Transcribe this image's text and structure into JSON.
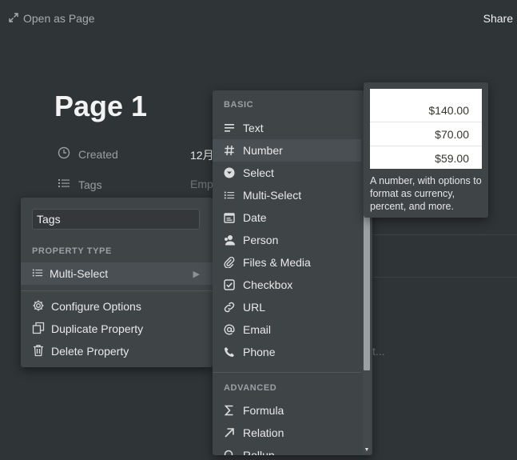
{
  "topbar": {
    "open_as_page": "Open as Page",
    "share": "Share"
  },
  "page": {
    "title": "Page 1",
    "properties": [
      {
        "name": "Created",
        "value": "12月"
      },
      {
        "name": "Tags",
        "value": "Emp"
      }
    ],
    "hidden_text": "t..."
  },
  "prop_menu": {
    "name_value": "Tags",
    "type_header": "PROPERTY TYPE",
    "current_type": "Multi-Select",
    "actions": [
      "Configure Options",
      "Duplicate Property",
      "Delete Property"
    ]
  },
  "type_menu": {
    "basic_header": "BASIC",
    "basic": [
      "Text",
      "Number",
      "Select",
      "Multi-Select",
      "Date",
      "Person",
      "Files & Media",
      "Checkbox",
      "URL",
      "Email",
      "Phone"
    ],
    "advanced_header": "ADVANCED",
    "advanced": [
      "Formula",
      "Relation",
      "Rollup"
    ]
  },
  "tooltip": {
    "values": [
      "$140.00",
      "$70.00",
      "$59.00"
    ],
    "description": "A number, with options to format as currency, percent, and more."
  }
}
